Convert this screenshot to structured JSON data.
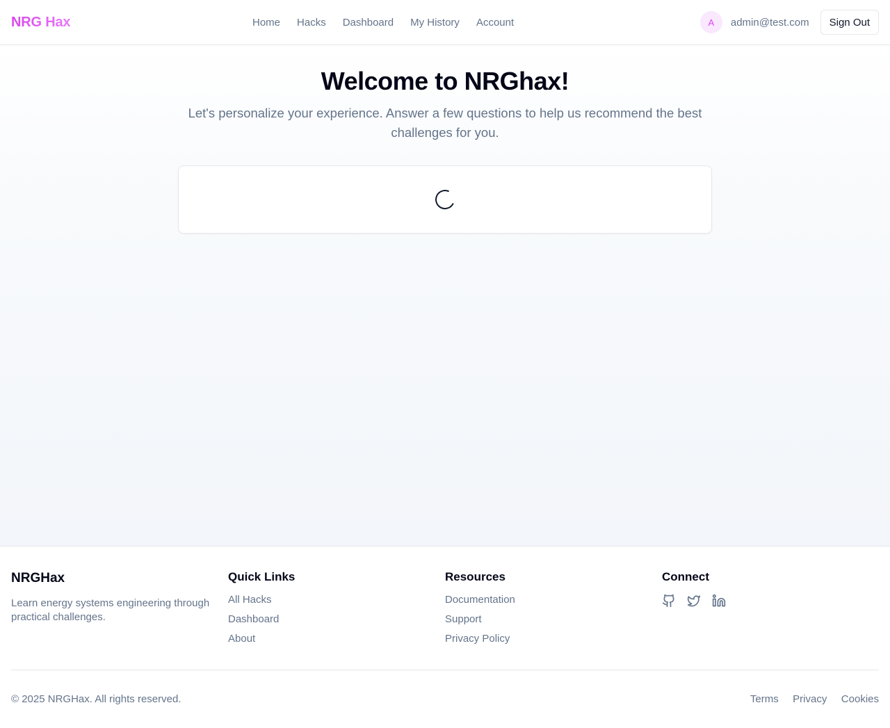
{
  "header": {
    "brand": "NRG Hax",
    "nav": [
      "Home",
      "Hacks",
      "Dashboard",
      "My History",
      "Account"
    ],
    "avatar_initial": "A",
    "email": "admin@test.com",
    "sign_out": "Sign Out"
  },
  "main": {
    "title": "Welcome to NRGhax!",
    "subtitle": "Let's personalize your experience. Answer a few questions to help us recommend the best challenges for you."
  },
  "footer": {
    "brand": "NRGHax",
    "description": "Learn energy systems engineering through practical challenges.",
    "quick_links": {
      "heading": "Quick Links",
      "items": [
        "All Hacks",
        "Dashboard",
        "About"
      ]
    },
    "resources": {
      "heading": "Resources",
      "items": [
        "Documentation",
        "Support",
        "Privacy Policy"
      ]
    },
    "connect": {
      "heading": "Connect",
      "icons": [
        "github-icon",
        "twitter-icon",
        "linkedin-icon"
      ]
    },
    "copyright": "© 2025 NRGHax. All rights reserved.",
    "legal": [
      "Terms",
      "Privacy",
      "Cookies"
    ]
  },
  "colors": {
    "brand": "#d946ef",
    "muted_text": "#64748b",
    "border": "#e5e7eb"
  }
}
